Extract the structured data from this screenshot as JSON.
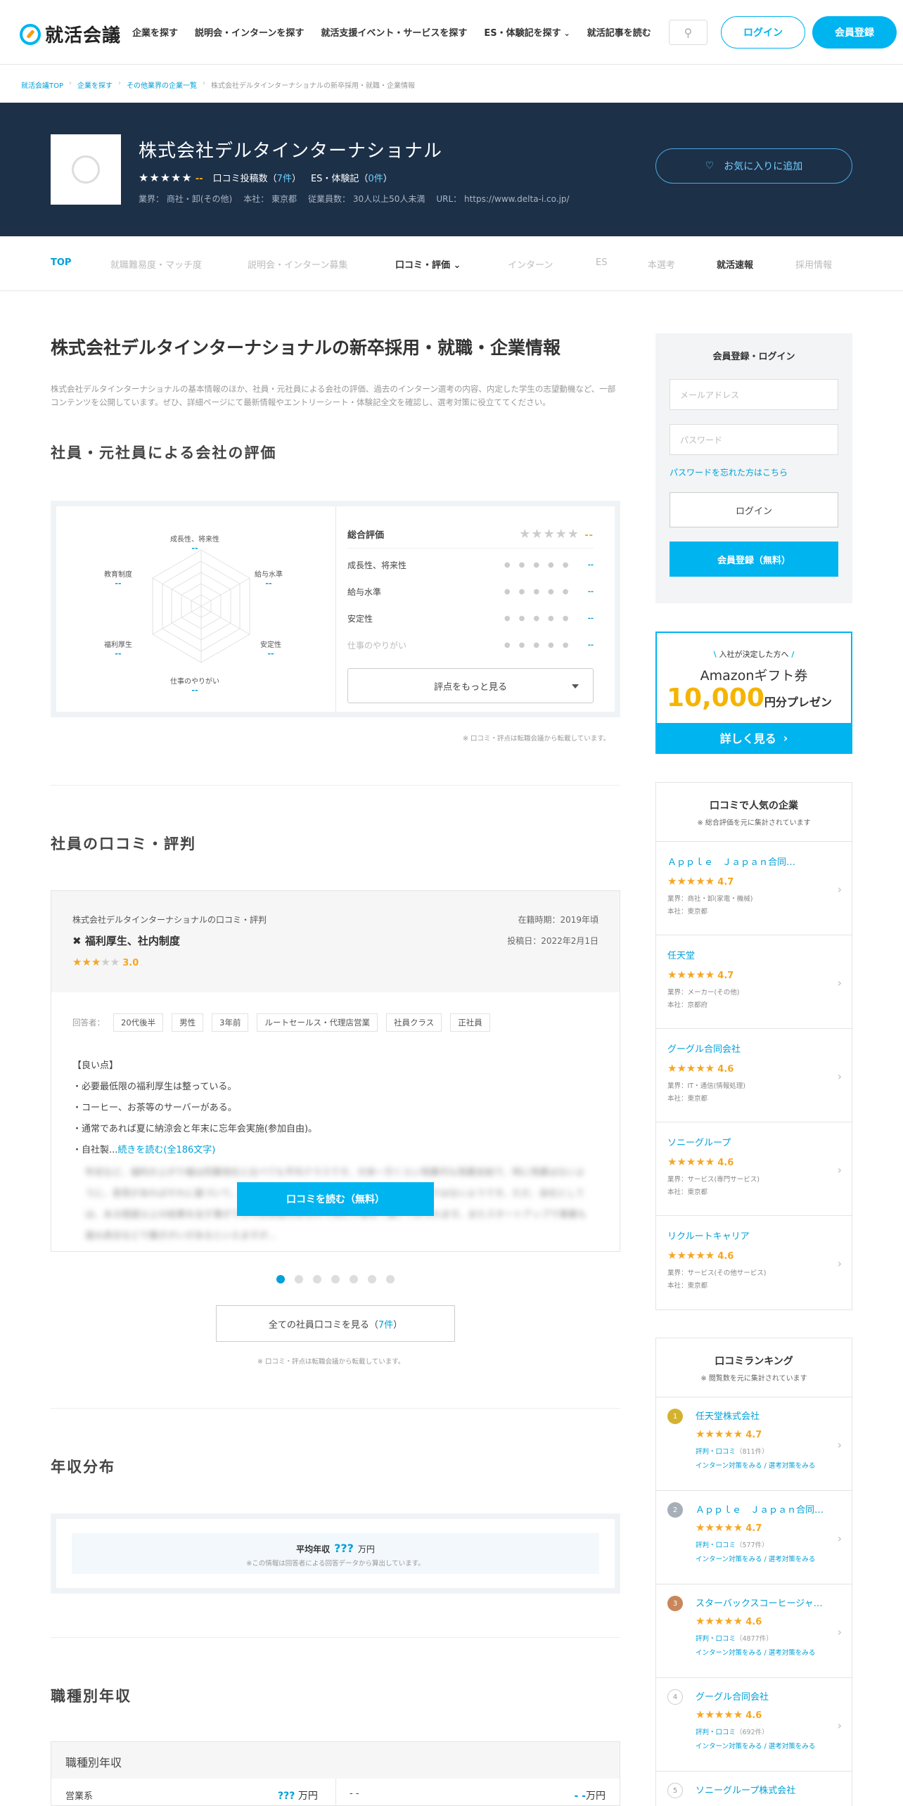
{
  "header": {
    "logo_text": "就活会議",
    "nav": [
      "企業を探す",
      "説明会・インターンを探す",
      "就活支援イベント・サービスを探す",
      "ES・体験記を探す",
      "就活記事を読む"
    ],
    "login": "ログイン",
    "register": "会員登録"
  },
  "breadcrumb": [
    "就活会議TOP",
    "企業を探す",
    "その他業界の企業一覧",
    "株式会社デルタインターナショナルの新卒採用・就職・企業情報"
  ],
  "company": {
    "name": "株式会社デルタインターナショナル",
    "rating": "--",
    "review_count_label": "口コミ投稿数（",
    "review_count": "7件",
    "es_label": "ES・体験記（",
    "es_count": "0件",
    "industry": "業界： 商社・卸(その他)",
    "hq": "本社： 東京都",
    "employees": "従業員数： 30人以上50人未満",
    "url": "URL： https://www.delta-i.co.jp/",
    "favorite": "お気に入りに追加"
  },
  "tabs": [
    "TOP",
    "就職難易度・マッチ度",
    "説明会・インターン募集",
    "口コミ・評価",
    "インターン",
    "ES",
    "本選考",
    "就活速報",
    "採用情報"
  ],
  "main": {
    "title": "株式会社デルタインターナショナルの新卒採用・就職・企業情報",
    "lead": "株式会社デルタインターナショナルの基本情報のほか、社員・元社員による会社の評価、過去のインターン選考の内容、内定した学生の志望動機など、一部コンテンツを公開しています。ぜひ、詳細ページにて最新情報やエントリーシート・体験記全文を確認し、選考対策に役立ててください。",
    "eval_heading": "社員・元社員による会社の評価",
    "radar_labels": [
      "成長性、将来性",
      "給与水準",
      "安定性",
      "仕事のやりがい",
      "福利厚生",
      "教育制度"
    ],
    "radar_value": "--",
    "total_label": "総合評価",
    "score_rows": [
      "成長性、将来性",
      "給与水準",
      "安定性",
      "仕事のやりがい"
    ],
    "more_scores": "評点をもっと見る",
    "note": "※ 口コミ・評点は転職会議から転載しています。",
    "review_heading": "社員の口コミ・評判",
    "review": {
      "title": "株式会社デルタインターナショナルの口コミ・評判",
      "category": "福利厚生、社内制度",
      "score": "3.0",
      "period": "在籍時期：2019年頃",
      "posted": "投稿日：2022年2月1日",
      "respondent_label": "回答者：",
      "chips": [
        "20代後半",
        "男性",
        "3年前",
        "ルートセールス・代理店営業",
        "社員クラス",
        "正社員"
      ],
      "body": [
        "【良い点】",
        "・必要最低限の福利厚生は整っている。",
        "・コーヒー、お茶等のサーバーがある。",
        "・通常であれば夏に納涼会と年末に忘年会実施(参加自由)。",
        "・自社製..."
      ],
      "read_more": "続きを読む(全186文字)",
      "blurred": "年収など、福利の上がり幅は同業他社と比べても平均クラスです。大体一万くらい残業代も残業支給で、特に残業はないように、意見があればそれに基づいて、部署毎に大体のペースで評価できるというわけではないようです。ただ、会社としては、ある程度以上の結果を出す事ができれば昇給もあるので特に不満なく働いておられます。またスタートアップで事業も進み具合などで働きがいがあるといえますが...",
      "read_button": "口コミを読む（無料）"
    },
    "all_reviews_prefix": "全ての社員口コミを見る（",
    "all_reviews_count": "7件",
    "all_reviews_suffix": "）",
    "income_heading": "年収分布",
    "income_label": "平均年収",
    "income_value": "???",
    "income_unit": "万円",
    "income_note": "※この情報は回答者による回答データから算出しています。",
    "job_heading": "職種別年収",
    "job_table_title": "職種別年収",
    "job_row": {
      "name1": "営業系",
      "val1": "???",
      "name2": "- -",
      "val2": "- -",
      "unit": "万円"
    }
  },
  "sidebar": {
    "login_title": "会員登録・ログイン",
    "email_placeholder": "メールアドレス",
    "password_placeholder": "パスワード",
    "forgot": "パスワードを忘れた方はこちら",
    "login": "ログイン",
    "register": "会員登録（無料）",
    "amazon": {
      "line1": "入社が決定した方へ",
      "line2": "Amazonギフト券",
      "amount": "10,000",
      "amount_suffix": "円分プレゼント！",
      "button": "詳しく見る"
    },
    "popular": {
      "title": "口コミで人気の企業",
      "subtitle": "※ 総合評価を元に集計されています",
      "items": [
        {
          "name": "Ａｐｐｌｅ　Ｊａｐａｎ合同…",
          "score": "4.7",
          "industry": "業界：商社・卸(家電・機械)",
          "hq": "本社：東京都"
        },
        {
          "name": "任天堂",
          "score": "4.7",
          "industry": "業界：メーカー(その他)",
          "hq": "本社：京都府"
        },
        {
          "name": "グーグル合同会社",
          "score": "4.6",
          "industry": "業界：IT・通信(情報処理)",
          "hq": "本社：東京都"
        },
        {
          "name": "ソニーグループ",
          "score": "4.6",
          "industry": "業界：サービス(専門サービス)",
          "hq": "本社：東京都"
        },
        {
          "name": "リクルートキャリア",
          "score": "4.6",
          "industry": "業界：サービス(その他サービス)",
          "hq": "本社：東京都"
        }
      ]
    },
    "ranking": {
      "title": "口コミランキング",
      "subtitle": "※ 閲覧数を元に集計されています",
      "review_label": "評判・口コミ",
      "links": "インターン対策をみる / 選考対策をみる",
      "items": [
        {
          "rank": "1",
          "name": "任天堂株式会社",
          "score": "4.7",
          "count": "（811件）",
          "color": "#d4b22f"
        },
        {
          "rank": "2",
          "name": "Ａｐｐｌｅ　Ｊａｐａｎ合同…",
          "score": "4.7",
          "count": "（577件）",
          "color": "#a6aeb8"
        },
        {
          "rank": "3",
          "name": "スターバックスコーヒージャ…",
          "score": "4.6",
          "count": "（4877件）",
          "color": "#c8865a"
        },
        {
          "rank": "4",
          "name": "グーグル合同会社",
          "score": "4.6",
          "count": "（692件）",
          "color": "#ffffff"
        },
        {
          "rank": "5",
          "name": "ソニーグループ株式会社",
          "score": "",
          "count": "",
          "color": "#ffffff"
        }
      ]
    }
  }
}
